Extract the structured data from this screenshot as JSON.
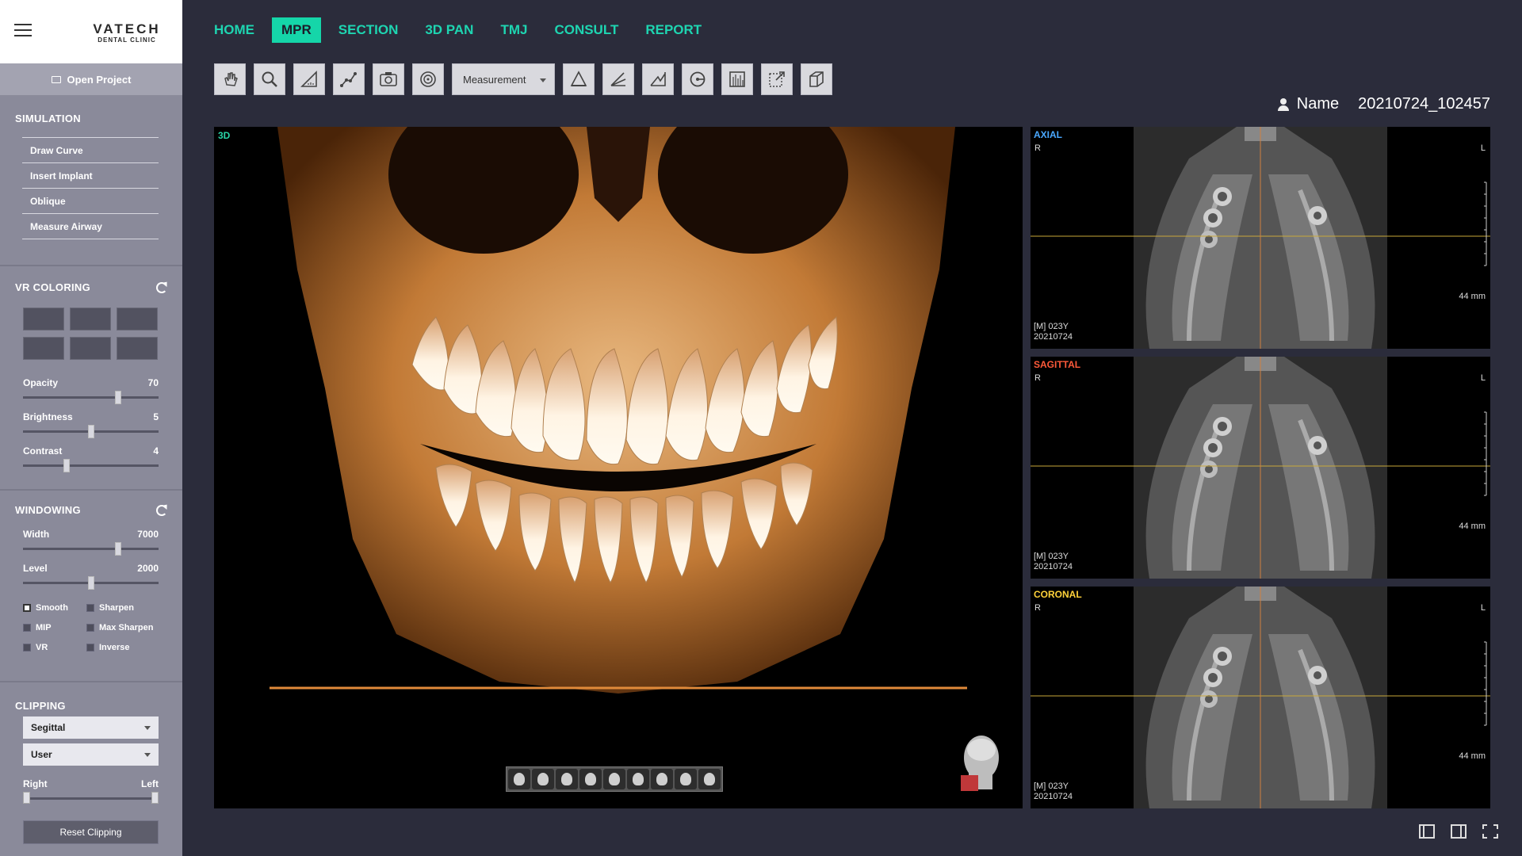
{
  "brand": {
    "name": "VATECH",
    "subtitle": "DENTAL CLINIC"
  },
  "open_project": "Open Project",
  "simulation": {
    "title": "SIMULATION",
    "items": [
      "Draw Curve",
      "Insert Implant",
      "Oblique",
      "Measure Airway"
    ]
  },
  "vr_coloring": {
    "title": "VR COLORING",
    "sliders": [
      {
        "label": "Opacity",
        "value": "70",
        "fraction": 0.7
      },
      {
        "label": "Brightness",
        "value": "5",
        "fraction": 0.5
      },
      {
        "label": "Contrast",
        "value": "4",
        "fraction": 0.32
      }
    ]
  },
  "windowing": {
    "title": "WINDOWING",
    "sliders": [
      {
        "label": "Width",
        "value": "7000",
        "fraction": 0.7
      },
      {
        "label": "Level",
        "value": "2000",
        "fraction": 0.5
      }
    ],
    "options": [
      {
        "label": "Smooth",
        "checked": true
      },
      {
        "label": "Sharpen",
        "checked": false
      },
      {
        "label": "MIP",
        "checked": false
      },
      {
        "label": "Max Sharpen",
        "checked": false
      },
      {
        "label": "VR",
        "checked": false
      },
      {
        "label": "Inverse",
        "checked": false
      }
    ]
  },
  "clipping": {
    "title": "CLIPPING",
    "plane": "Segittal",
    "mode": "User",
    "right_label": "Right",
    "left_label": "Left",
    "reset_label": "Reset Clipping"
  },
  "nav": {
    "tabs": [
      "HOME",
      "MPR",
      "SECTION",
      "3D PAN",
      "TMJ",
      "CONSULT",
      "REPORT"
    ],
    "active": "MPR"
  },
  "toolbar": {
    "measurement_label": "Measurement",
    "icons": [
      "pan-icon",
      "zoom-icon",
      "ruler-icon",
      "polyline-icon",
      "camera-icon",
      "reset-view-icon"
    ],
    "icons_right": [
      "angle-icon",
      "area-icon",
      "profile-icon",
      "rotate-icon",
      "histogram-icon",
      "export-icon",
      "cube-icon"
    ]
  },
  "patient": {
    "label": "Name",
    "id": "20210724_102457"
  },
  "viewport3d": {
    "label": "3D"
  },
  "mpr_panels": [
    {
      "label": "AXIAL",
      "color": "#4aa8ff",
      "r": "R",
      "l": "L",
      "mm": "44 mm",
      "info1": "[M] 023Y",
      "info2": "20210724"
    },
    {
      "label": "SAGITTAL",
      "color": "#ff5a3a",
      "r": "R",
      "l": "L",
      "mm": "44 mm",
      "info1": "[M] 023Y",
      "info2": "20210724"
    },
    {
      "label": "CORONAL",
      "color": "#ffd23a",
      "r": "R",
      "l": "L",
      "mm": "44 mm",
      "info1": "[M] 023Y",
      "info2": "20210724"
    }
  ],
  "colors": {
    "accent": "#15d6a9",
    "background": "#2b2c3b",
    "sidebar": "#8a8a9a"
  }
}
